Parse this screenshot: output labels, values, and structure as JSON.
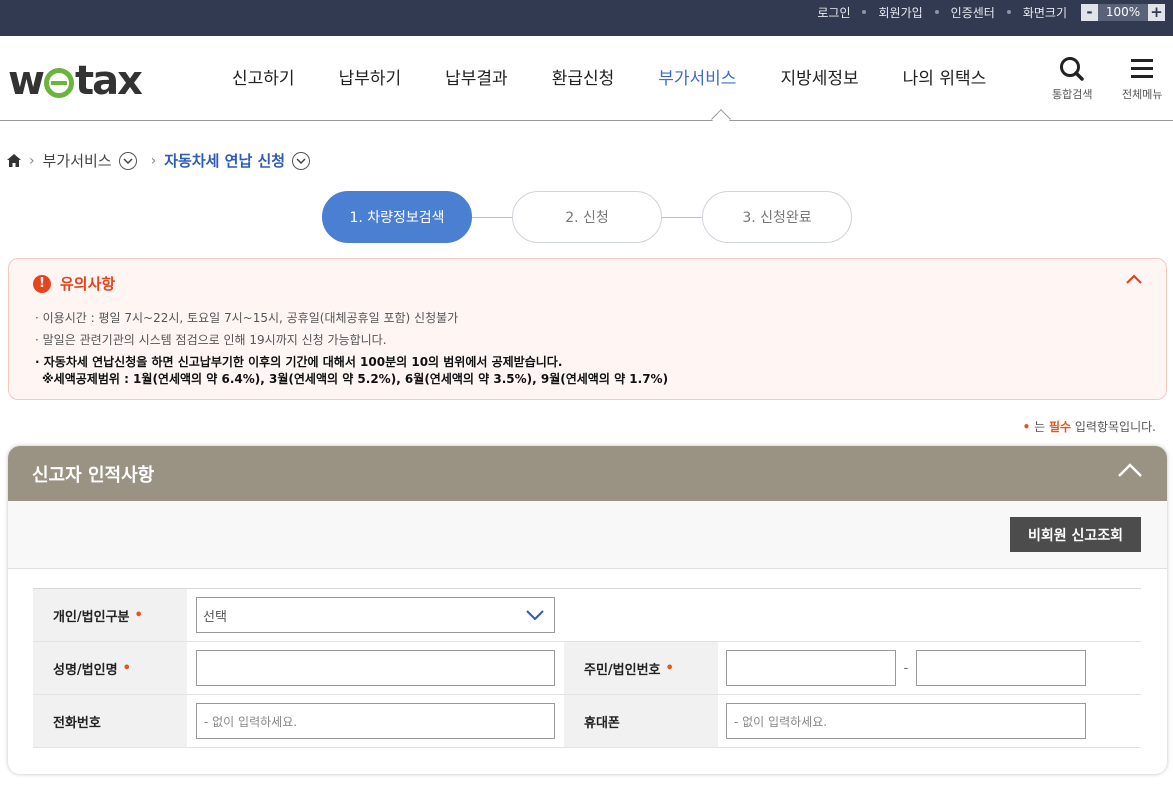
{
  "topbar": {
    "links": [
      "로그인",
      "회원가입",
      "인증센터",
      "화면크기"
    ],
    "zoom_minus": "-",
    "zoom_value": "100%",
    "zoom_plus": "+"
  },
  "header": {
    "logo_left": "w",
    "logo_right": "tax",
    "nav": [
      "신고하기",
      "납부하기",
      "납부결과",
      "환급신청",
      "부가서비스",
      "지방세정보",
      "나의 위택스"
    ],
    "active_nav": "부가서비스",
    "search_label": "통합검색",
    "menu_label": "전체메뉴"
  },
  "breadcrumb": {
    "parent": "부가서비스",
    "current": "자동차세 연납 신청"
  },
  "steps": [
    "1. 차량정보검색",
    "2. 신청",
    "3. 신청완료"
  ],
  "notice": {
    "title": "유의사항",
    "items": [
      "이용시간 : 평일 7시~22시, 토요일 7시~15시, 공휴일(대체공휴일 포함) 신청불가",
      "말일은 관련기관의 시스템 점검으로 인해 19시까지 신청 가능합니다."
    ],
    "strong_line1": "자동차세 연납신청을 하면 신고납부기한 이후의 기간에 대해서 100분의 10의 범위에서 공제받습니다.",
    "strong_line2": "※세액공제범위 : 1월(연세액의 약 6.4%), 3월(연세액의 약 5.2%), 6월(연세액의 약 3.5%), 9월(연세액의 약 1.7%)"
  },
  "required_note": {
    "prefix": "는",
    "word": "필수",
    "suffix": "입력항목입니다."
  },
  "panel": {
    "title": "신고자 인적사항",
    "nonmember_button": "비회원 신고조회",
    "fields": {
      "type_label": "개인/법인구분",
      "type_value": "선택",
      "name_label": "성명/법인명",
      "id_label": "주민/법인번호",
      "id_dash": "-",
      "phone_label": "전화번호",
      "phone_placeholder": "- 없이 입력하세요.",
      "mobile_label": "휴대폰",
      "mobile_placeholder": "- 없이 입력하세요."
    }
  },
  "colors": {
    "topbar": "#323a52",
    "accent_blue": "#4a7fd2",
    "notice_red": "#e5451e",
    "panel_head": "#9a9283",
    "logo_green": "#6db33f"
  }
}
